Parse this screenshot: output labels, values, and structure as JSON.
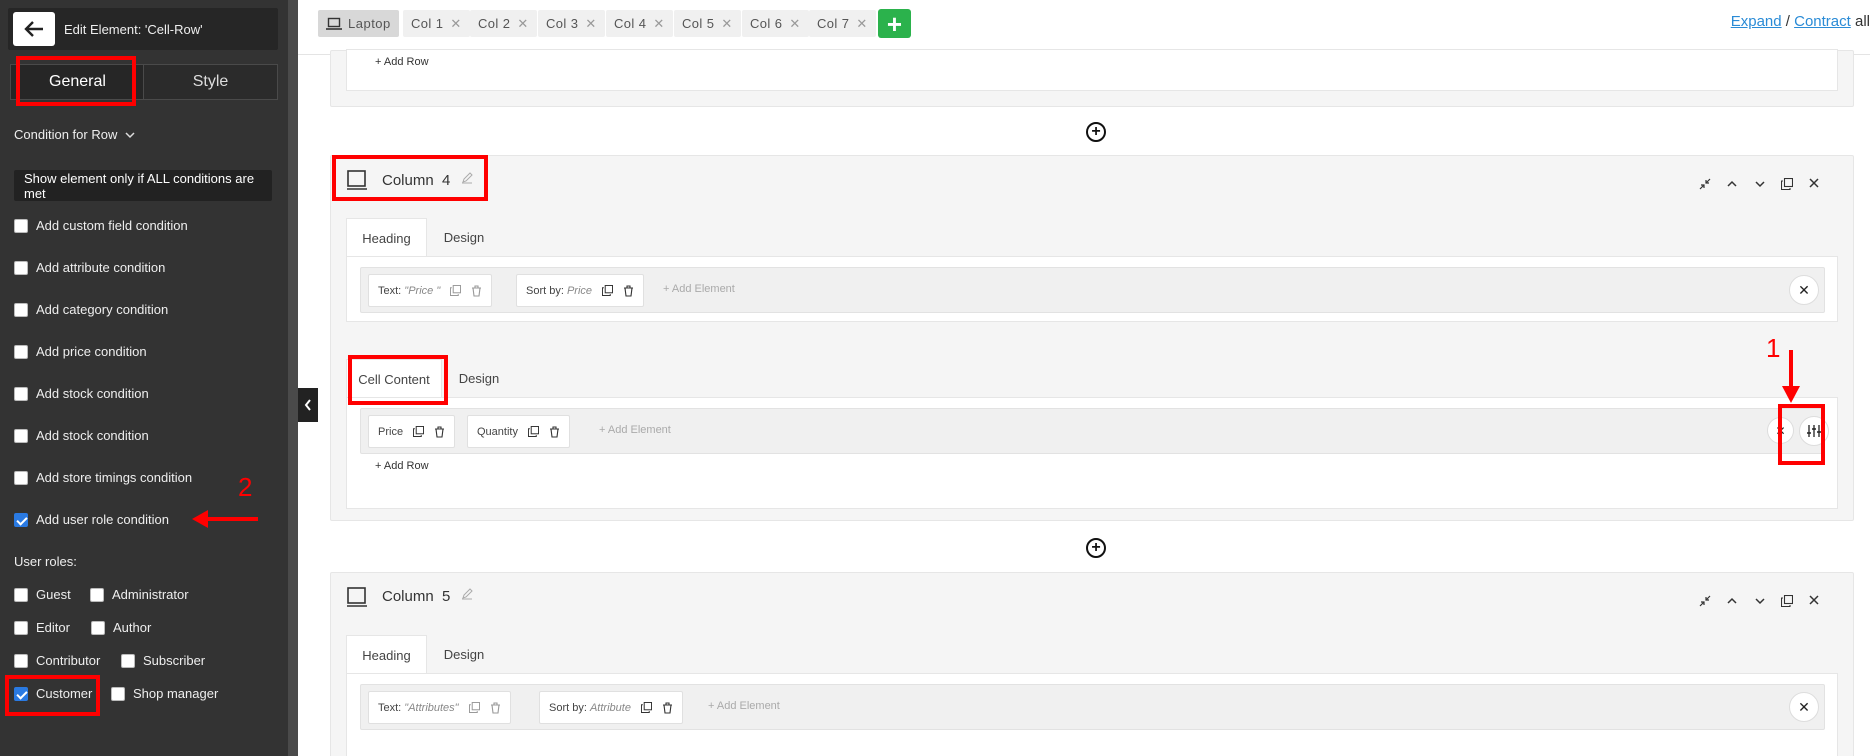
{
  "sidebar": {
    "title": "Edit Element: 'Cell-Row'",
    "tabs": [
      "General",
      "Style"
    ],
    "condition_label": "Condition for Row",
    "mode": "Show element only if ALL conditions are met",
    "conditions": [
      {
        "label": "Add custom field condition",
        "checked": false
      },
      {
        "label": "Add attribute condition",
        "checked": false
      },
      {
        "label": "Add category condition",
        "checked": false
      },
      {
        "label": "Add price condition",
        "checked": false
      },
      {
        "label": "Add stock condition",
        "checked": false
      },
      {
        "label": "Add stock condition",
        "checked": false
      },
      {
        "label": "Add store timings condition",
        "checked": false
      },
      {
        "label": "Add user role condition",
        "checked": true
      }
    ],
    "user_roles_label": "User roles:",
    "roles": [
      {
        "label": "Guest",
        "checked": false
      },
      {
        "label": "Administrator",
        "checked": false
      },
      {
        "label": "Editor",
        "checked": false
      },
      {
        "label": "Author",
        "checked": false
      },
      {
        "label": "Contributor",
        "checked": false
      },
      {
        "label": "Subscriber",
        "checked": false
      },
      {
        "label": "Customer",
        "checked": true
      },
      {
        "label": "Shop manager",
        "checked": false
      }
    ]
  },
  "topbar": {
    "device": "Laptop",
    "columns": [
      "Col 1",
      "Col 2",
      "Col 3",
      "Col 4",
      "Col 5",
      "Col 6",
      "Col 7"
    ],
    "add_column": "+",
    "expand": "Expand",
    "separator": "/",
    "contract": "Contract",
    "all": "all"
  },
  "main": {
    "add_row": "+ Add Row",
    "add_element": "+ Add Element",
    "column4": {
      "title": "Column",
      "number": "4",
      "heading_tabs": [
        "Heading",
        "Design"
      ],
      "heading_elements": [
        {
          "label": "Text:",
          "value": "\"Price \""
        },
        {
          "label": "Sort by:",
          "value": "Price"
        }
      ],
      "cell_tabs": [
        "Cell Content",
        "Design"
      ],
      "cell_elements": [
        "Price",
        "Quantity"
      ]
    },
    "column5": {
      "title": "Column",
      "number": "5",
      "heading_tabs": [
        "Heading",
        "Design"
      ],
      "heading_elements": [
        {
          "label": "Text:",
          "value": "\"Attributes\""
        },
        {
          "label": "Sort by:",
          "value": "Attribute"
        }
      ]
    }
  },
  "annotations": {
    "step1": "1",
    "step2": "2",
    "color": "#ff0000"
  }
}
